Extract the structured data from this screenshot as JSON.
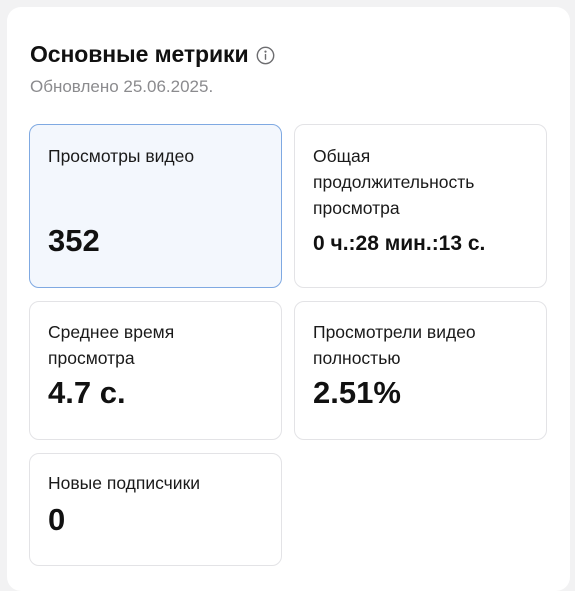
{
  "header": {
    "title": "Основные метрики",
    "info_icon": "info-circle-icon",
    "updated": "Обновлено 25.06.2025."
  },
  "metrics": [
    {
      "label": "Просмотры видео",
      "value": "352",
      "selected": true
    },
    {
      "label": "Общая продолжительность просмотра",
      "value": "0 ч.:28 мин.:13 с.",
      "selected": false
    },
    {
      "label": "Среднее время просмотра",
      "value": "4.7 с.",
      "selected": false
    },
    {
      "label": "Просмотрели видео полностью",
      "value": "2.51%",
      "selected": false
    },
    {
      "label": "Новые подписчики",
      "value": "0",
      "selected": false
    }
  ],
  "colors": {
    "selected_border": "#7fa9e2",
    "selected_background": "#f3f7fd",
    "card_border": "#e3e3e6",
    "subtitle": "#8b8b8e"
  }
}
